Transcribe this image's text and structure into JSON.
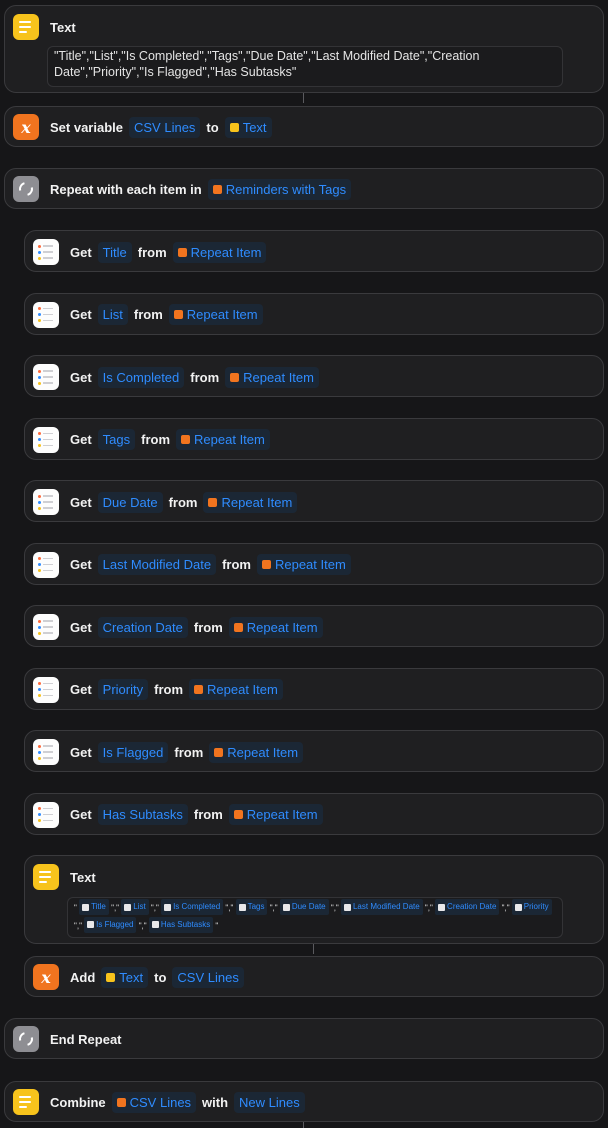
{
  "text_action_1": {
    "title": "Text",
    "content": "\"Title\",\"List\",\"Is Completed\",\"Tags\",\"Due Date\",\"Last Modified Date\",\"Creation Date\",\"Priority\",\"Is Flagged\",\"Has Subtasks\""
  },
  "set_variable": {
    "label": "Set variable",
    "variable": "CSV Lines",
    "to": "to",
    "value": "Text"
  },
  "repeat": {
    "label": "Repeat with each item in",
    "source": "Reminders with Tags"
  },
  "get_actions": [
    {
      "get": "Get",
      "property": "Title",
      "from": "from",
      "item": "Repeat Item"
    },
    {
      "get": "Get",
      "property": "List",
      "from": "from",
      "item": "Repeat Item"
    },
    {
      "get": "Get",
      "property": "Is Completed",
      "from": "from",
      "item": "Repeat Item"
    },
    {
      "get": "Get",
      "property": "Tags",
      "from": "from",
      "item": "Repeat Item"
    },
    {
      "get": "Get",
      "property": "Due Date",
      "from": "from",
      "item": "Repeat Item"
    },
    {
      "get": "Get",
      "property": "Last Modified Date",
      "from": "from",
      "item": "Repeat Item"
    },
    {
      "get": "Get",
      "property": "Creation Date",
      "from": "from",
      "item": "Repeat Item"
    },
    {
      "get": "Get",
      "property": "Priority",
      "from": "from",
      "item": "Repeat Item"
    },
    {
      "get": "Get",
      "property": "Is Flagged",
      "from": "from",
      "item": "Repeat Item"
    },
    {
      "get": "Get",
      "property": "Has Subtasks",
      "from": "from",
      "item": "Repeat Item"
    }
  ],
  "text_action_2": {
    "title": "Text",
    "tokens": [
      "Title",
      "List",
      "Is Completed",
      "Tags",
      "Due Date",
      "Last Modified Date",
      "Creation Date",
      "Priority",
      "Is Flagged",
      "Has Subtasks"
    ],
    "quote": "\"",
    "separator": "\",\""
  },
  "add_action": {
    "label": "Add",
    "value": "Text",
    "to": "to",
    "target": "CSV Lines"
  },
  "end_repeat": {
    "label": "End Repeat"
  },
  "combine": {
    "label": "Combine",
    "source": "CSV Lines",
    "with": "with",
    "separator": "New Lines"
  }
}
